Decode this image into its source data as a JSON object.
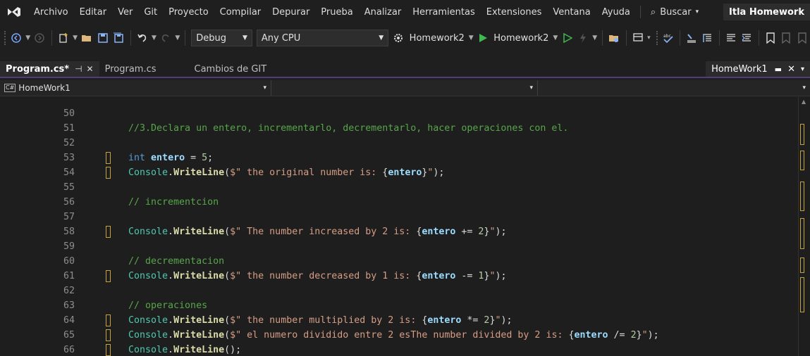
{
  "menu": {
    "items": [
      "Archivo",
      "Editar",
      "Ver",
      "Git",
      "Proyecto",
      "Compilar",
      "Depurar",
      "Prueba",
      "Analizar",
      "Herramientas",
      "Extensiones",
      "Ventana",
      "Ayuda"
    ],
    "search_label": "Buscar",
    "solution_name": "Itla Homework"
  },
  "toolbar": {
    "configuration": "Debug",
    "platform": "Any CPU",
    "startup_project": "Homework2",
    "run_target": "Homework2"
  },
  "tabs": {
    "items": [
      {
        "label": "Program.cs*",
        "active": true
      },
      {
        "label": "Program.cs",
        "active": false
      },
      {
        "label": "Cambios de GIT",
        "active": false
      }
    ],
    "right_label": "HomeWork1"
  },
  "navbar": {
    "project": "HomeWork1",
    "type": "",
    "member": ""
  },
  "editor": {
    "lines": [
      {
        "n": "50",
        "mark": false,
        "html": ""
      },
      {
        "n": "51",
        "mark": false,
        "html": "<span class='cmt'>//3.Declara un entero, incrementarlo, decrementarlo, hacer operaciones con el.</span>"
      },
      {
        "n": "52",
        "mark": false,
        "html": ""
      },
      {
        "n": "53",
        "mark": true,
        "html": "<span class='kw'>int</span> <span class='var'>entero</span> = <span class='num'>5</span>;"
      },
      {
        "n": "54",
        "mark": true,
        "html": "<span class='cls'>Console</span>.<span class='mth'>WriteLine</span>(<span class='str'>$\" the original number is: </span>{<span class='var'>entero</span>}<span class='str'>\"</span>);"
      },
      {
        "n": "55",
        "mark": false,
        "html": ""
      },
      {
        "n": "56",
        "mark": false,
        "html": "<span class='cmt'>// incrementcion</span>"
      },
      {
        "n": "57",
        "mark": false,
        "html": ""
      },
      {
        "n": "58",
        "mark": true,
        "html": "<span class='cls'>Console</span>.<span class='mth'>WriteLine</span>(<span class='str'>$\" The number increased by 2 is: </span>{<span class='var'>entero</span> += <span class='num'>2</span>}<span class='str'>\"</span>);"
      },
      {
        "n": "59",
        "mark": false,
        "html": ""
      },
      {
        "n": "60",
        "mark": false,
        "html": "<span class='cmt'>// decrementacion</span>"
      },
      {
        "n": "61",
        "mark": true,
        "html": "<span class='cls'>Console</span>.<span class='mth'>WriteLine</span>(<span class='str'>$\" the number decreased by 1 is: </span>{<span class='var'>entero</span> -= <span class='num'>1</span>}<span class='str'>\"</span>);"
      },
      {
        "n": "62",
        "mark": false,
        "html": ""
      },
      {
        "n": "63",
        "mark": false,
        "html": "<span class='cmt'>// operaciones</span>"
      },
      {
        "n": "64",
        "mark": true,
        "html": "<span class='cls'>Console</span>.<span class='mth'>WriteLine</span>(<span class='str'>$\" the number multiplied by 2 is: </span>{<span class='var'>entero</span> *= <span class='num'>2</span>}<span class='str'>\"</span>);"
      },
      {
        "n": "65",
        "mark": true,
        "html": "<span class='cls'>Console</span>.<span class='mth'>WriteLine</span>(<span class='str'>$\" el numero dividido entre 2 esThe number divided by 2 is: </span>{<span class='var'>entero</span> /= <span class='num'>2</span>}<span class='str'>\"</span>);"
      },
      {
        "n": "66",
        "mark": true,
        "html": "<span class='cls'>Console</span>.<span class='mth'>WriteLine</span>();"
      }
    ]
  },
  "colors": {
    "accent": "#4f3e7a",
    "change_marker": "#c5a53b",
    "play": "#3fb950"
  }
}
